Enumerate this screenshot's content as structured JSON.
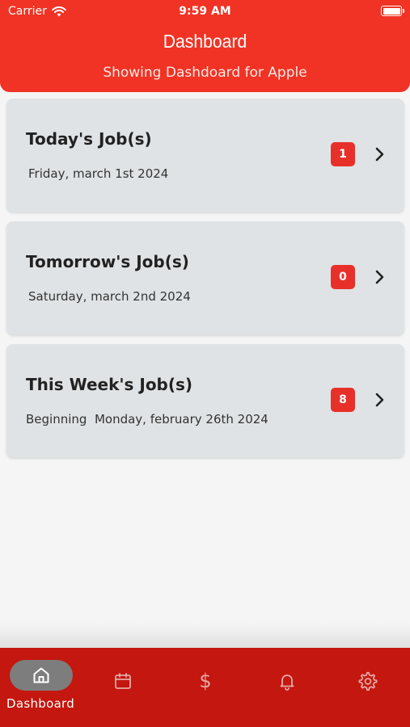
{
  "status_bar": {
    "carrier": "Carrier",
    "time": "9:59 AM"
  },
  "header": {
    "title": "Dashboard",
    "subtitle": "Showing Dashdoard for Apple",
    "color": "#f03324"
  },
  "cards": [
    {
      "title": "Today's Job(s)",
      "date": "Friday, march 1st 2024",
      "count": "1"
    },
    {
      "title": "Tomorrow's Job(s)",
      "date": "Saturday, march 2nd 2024",
      "count": "0"
    },
    {
      "title": "This Week's Job(s)",
      "date": "Beginning  Monday, february 26th 2024",
      "count": "8"
    }
  ],
  "tabbar": {
    "color": "#c3170f",
    "tabs": [
      {
        "label": "Dashboard",
        "icon": "home-icon",
        "selected": true
      },
      {
        "icon": "calendar-icon"
      },
      {
        "icon": "dollar-icon",
        "glyph": "$"
      },
      {
        "icon": "bell-icon"
      },
      {
        "icon": "gear-icon"
      }
    ]
  }
}
